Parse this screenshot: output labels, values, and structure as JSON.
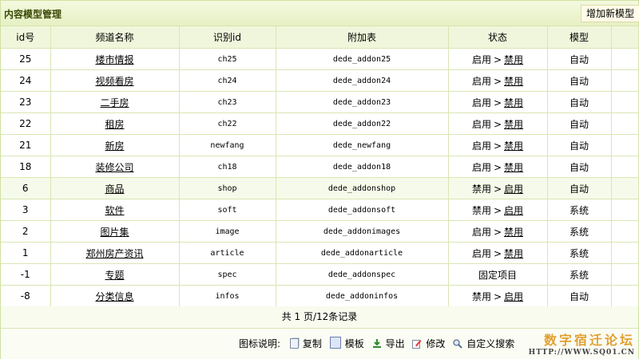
{
  "header": {
    "title": "内容模型管理",
    "add_button": "增加新模型"
  },
  "table": {
    "columns": [
      "id号",
      "频道名称",
      "识别id",
      "附加表",
      "状态",
      "模型"
    ],
    "rows": [
      {
        "id": "25",
        "name": "楼市情报",
        "nid": "ch25",
        "addtable": "dede_addon25",
        "status": "启用",
        "action": "禁用",
        "model": "自动"
      },
      {
        "id": "24",
        "name": "视频看房",
        "nid": "ch24",
        "addtable": "dede_addon24",
        "status": "启用",
        "action": "禁用",
        "model": "自动"
      },
      {
        "id": "23",
        "name": "二手房",
        "nid": "ch23",
        "addtable": "dede_addon23",
        "status": "启用",
        "action": "禁用",
        "model": "自动"
      },
      {
        "id": "22",
        "name": "租房",
        "nid": "ch22",
        "addtable": "dede_addon22",
        "status": "启用",
        "action": "禁用",
        "model": "自动"
      },
      {
        "id": "21",
        "name": "新房",
        "nid": "newfang",
        "addtable": "dede_newfang",
        "status": "启用",
        "action": "禁用",
        "model": "自动"
      },
      {
        "id": "18",
        "name": "装修公司",
        "nid": "ch18",
        "addtable": "dede_addon18",
        "status": "启用",
        "action": "禁用",
        "model": "自动"
      },
      {
        "id": "6",
        "name": "商品",
        "nid": "shop",
        "addtable": "dede_addonshop",
        "status": "禁用",
        "action": "启用",
        "model": "自动"
      },
      {
        "id": "3",
        "name": "软件",
        "nid": "soft",
        "addtable": "dede_addonsoft",
        "status": "禁用",
        "action": "启用",
        "model": "系统"
      },
      {
        "id": "2",
        "name": "图片集",
        "nid": "image",
        "addtable": "dede_addonimages",
        "status": "启用",
        "action": "禁用",
        "model": "系统"
      },
      {
        "id": "1",
        "name": "郑州房产资讯",
        "nid": "article",
        "addtable": "dede_addonarticle",
        "status": "启用",
        "action": "禁用",
        "model": "系统"
      },
      {
        "id": "-1",
        "name": "专题",
        "nid": "spec",
        "addtable": "dede_addonspec",
        "status": "固定项目",
        "action": "",
        "model": "系统"
      },
      {
        "id": "-8",
        "name": "分类信息",
        "nid": "infos",
        "addtable": "dede_addoninfos",
        "status": "禁用",
        "action": "启用",
        "model": "自动"
      }
    ],
    "highlight_row_index": 6
  },
  "pager": {
    "text": "共 1 页/12条记录"
  },
  "legend": {
    "label": "图标说明:",
    "items": [
      {
        "icon": "copy-icon",
        "label": "复制"
      },
      {
        "icon": "template-icon",
        "label": "模板"
      },
      {
        "icon": "export-icon",
        "label": "导出"
      },
      {
        "icon": "edit-icon",
        "label": "修改"
      },
      {
        "icon": "search-icon",
        "label": "自定义搜索"
      }
    ]
  },
  "watermark": {
    "main": "数字宿迁论坛",
    "sub": "HTTP://WWW.SQ01.CN"
  },
  "colors": {
    "header_bg": "#e6f0c4",
    "border": "#d9e6b3",
    "title": "#3b4a06",
    "watermark": "#e0a030"
  }
}
